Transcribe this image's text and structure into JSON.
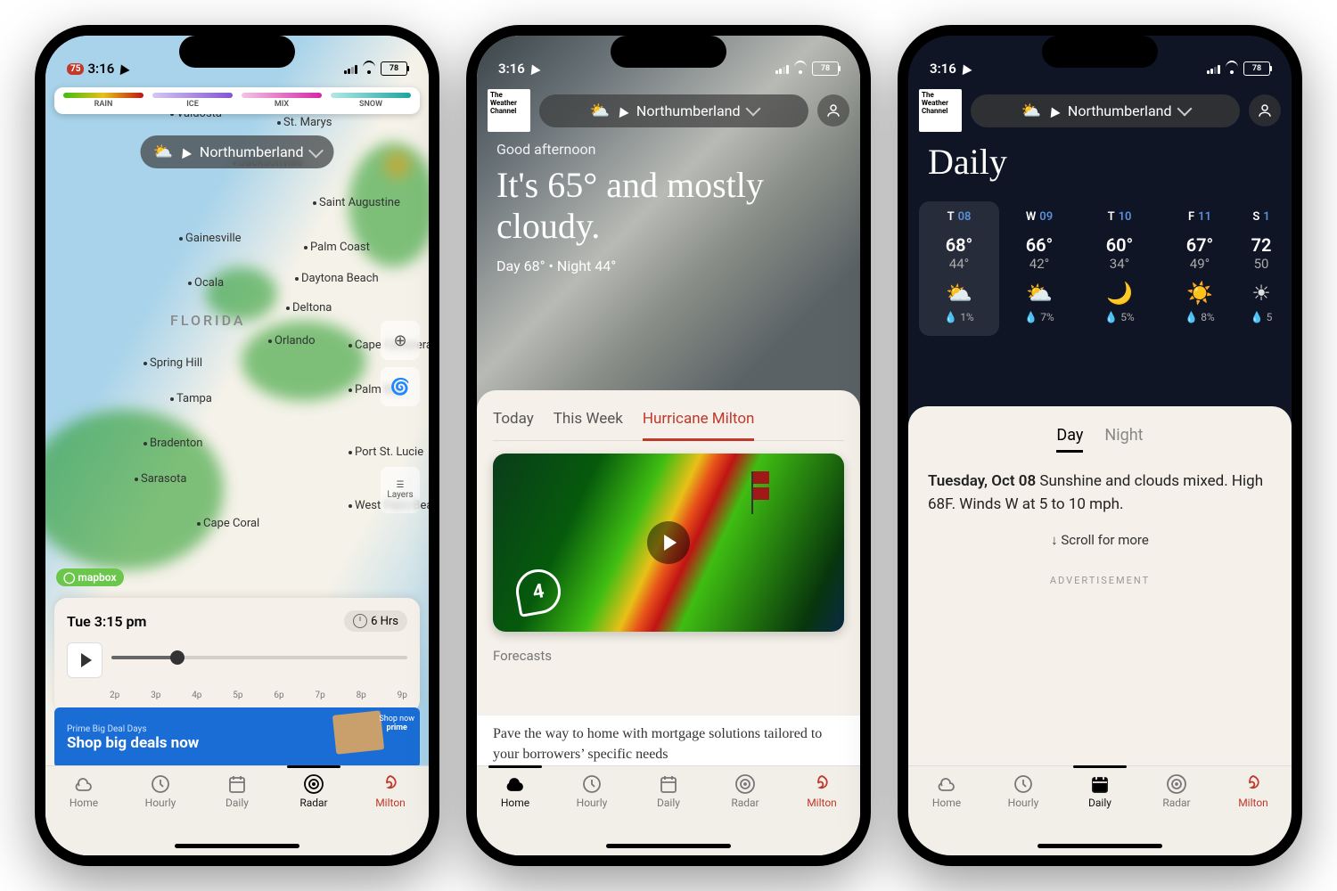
{
  "status": {
    "time": "3:16",
    "battery": "78"
  },
  "location_name": "Northumberland",
  "twc_logo": "The Weather Channel",
  "p1": {
    "legend": {
      "rain": "RAIN",
      "ice": "ICE",
      "mix": "MIX",
      "snow": "SNOW"
    },
    "state": "FLORIDA",
    "cities": {
      "valdosta": "Valdosta",
      "stmarys": "St. Marys",
      "jacksonville": "Jacksonville",
      "staugustine": "Saint Augustine",
      "gainesville": "Gainesville",
      "palmcoast": "Palm Coast",
      "ocala": "Ocala",
      "daytona": "Daytona Beach",
      "deltona": "Deltona",
      "orlando": "Orlando",
      "cape": "Cape Canaveral",
      "springhill": "Spring Hill",
      "tampa": "Tampa",
      "palmbay": "Palm Bay",
      "bradenton": "Bradenton",
      "portstlucie": "Port St. Lucie",
      "sarasota": "Sarasota",
      "westpalm": "West Palm Beach",
      "capecoral": "Cape Coral"
    },
    "mapbox": "mapbox",
    "layers_label": "Layers",
    "timeline": {
      "label": "Tue 3:15 pm",
      "range": "6 Hrs",
      "ticks": [
        "2p",
        "3p",
        "4p",
        "5p",
        "6p",
        "7p",
        "8p",
        "9p"
      ]
    },
    "ad": {
      "tag": "Prime Big Deal Days",
      "headline": "Shop big deals now",
      "cta": "Shop now",
      "brand": "prime"
    }
  },
  "p2": {
    "greeting": "Good afternoon",
    "headline": "It's 65° and mostly cloudy.",
    "subline": "Day 68°  •  Night 44°",
    "tabs": {
      "today": "Today",
      "week": "This Week",
      "milton": "Hurricane Milton"
    },
    "cat": "4",
    "forecasts": "Forecasts",
    "serif_ad": "Pave the way to home with mortgage solutions tailored to your borrowers’ specific needs"
  },
  "p3": {
    "title": "Daily",
    "days": [
      {
        "d": "T",
        "n": "08",
        "hi": "68°",
        "lo": "44°",
        "ic": "⛅",
        "p": "1%"
      },
      {
        "d": "W",
        "n": "09",
        "hi": "66°",
        "lo": "42°",
        "ic": "⛅",
        "p": "7%"
      },
      {
        "d": "T",
        "n": "10",
        "hi": "60°",
        "lo": "34°",
        "ic": "🌙",
        "p": "5%"
      },
      {
        "d": "F",
        "n": "11",
        "hi": "67°",
        "lo": "49°",
        "ic": "☀️",
        "p": "8%"
      },
      {
        "d": "S",
        "n": "1",
        "hi": "72",
        "lo": "50",
        "ic": "☀",
        "p": "5"
      }
    ],
    "dntabs": {
      "day": "Day",
      "night": "Night"
    },
    "desc_date": "Tuesday, Oct 08",
    "desc_body": " Sunshine and clouds mixed. High 68F. Winds W at 5 to 10 mph.",
    "scroll": "↓  Scroll for more",
    "adlabel": "ADVERTISEMENT"
  },
  "tabs": {
    "home": "Home",
    "hourly": "Hourly",
    "daily": "Daily",
    "radar": "Radar",
    "milton": "Milton"
  }
}
